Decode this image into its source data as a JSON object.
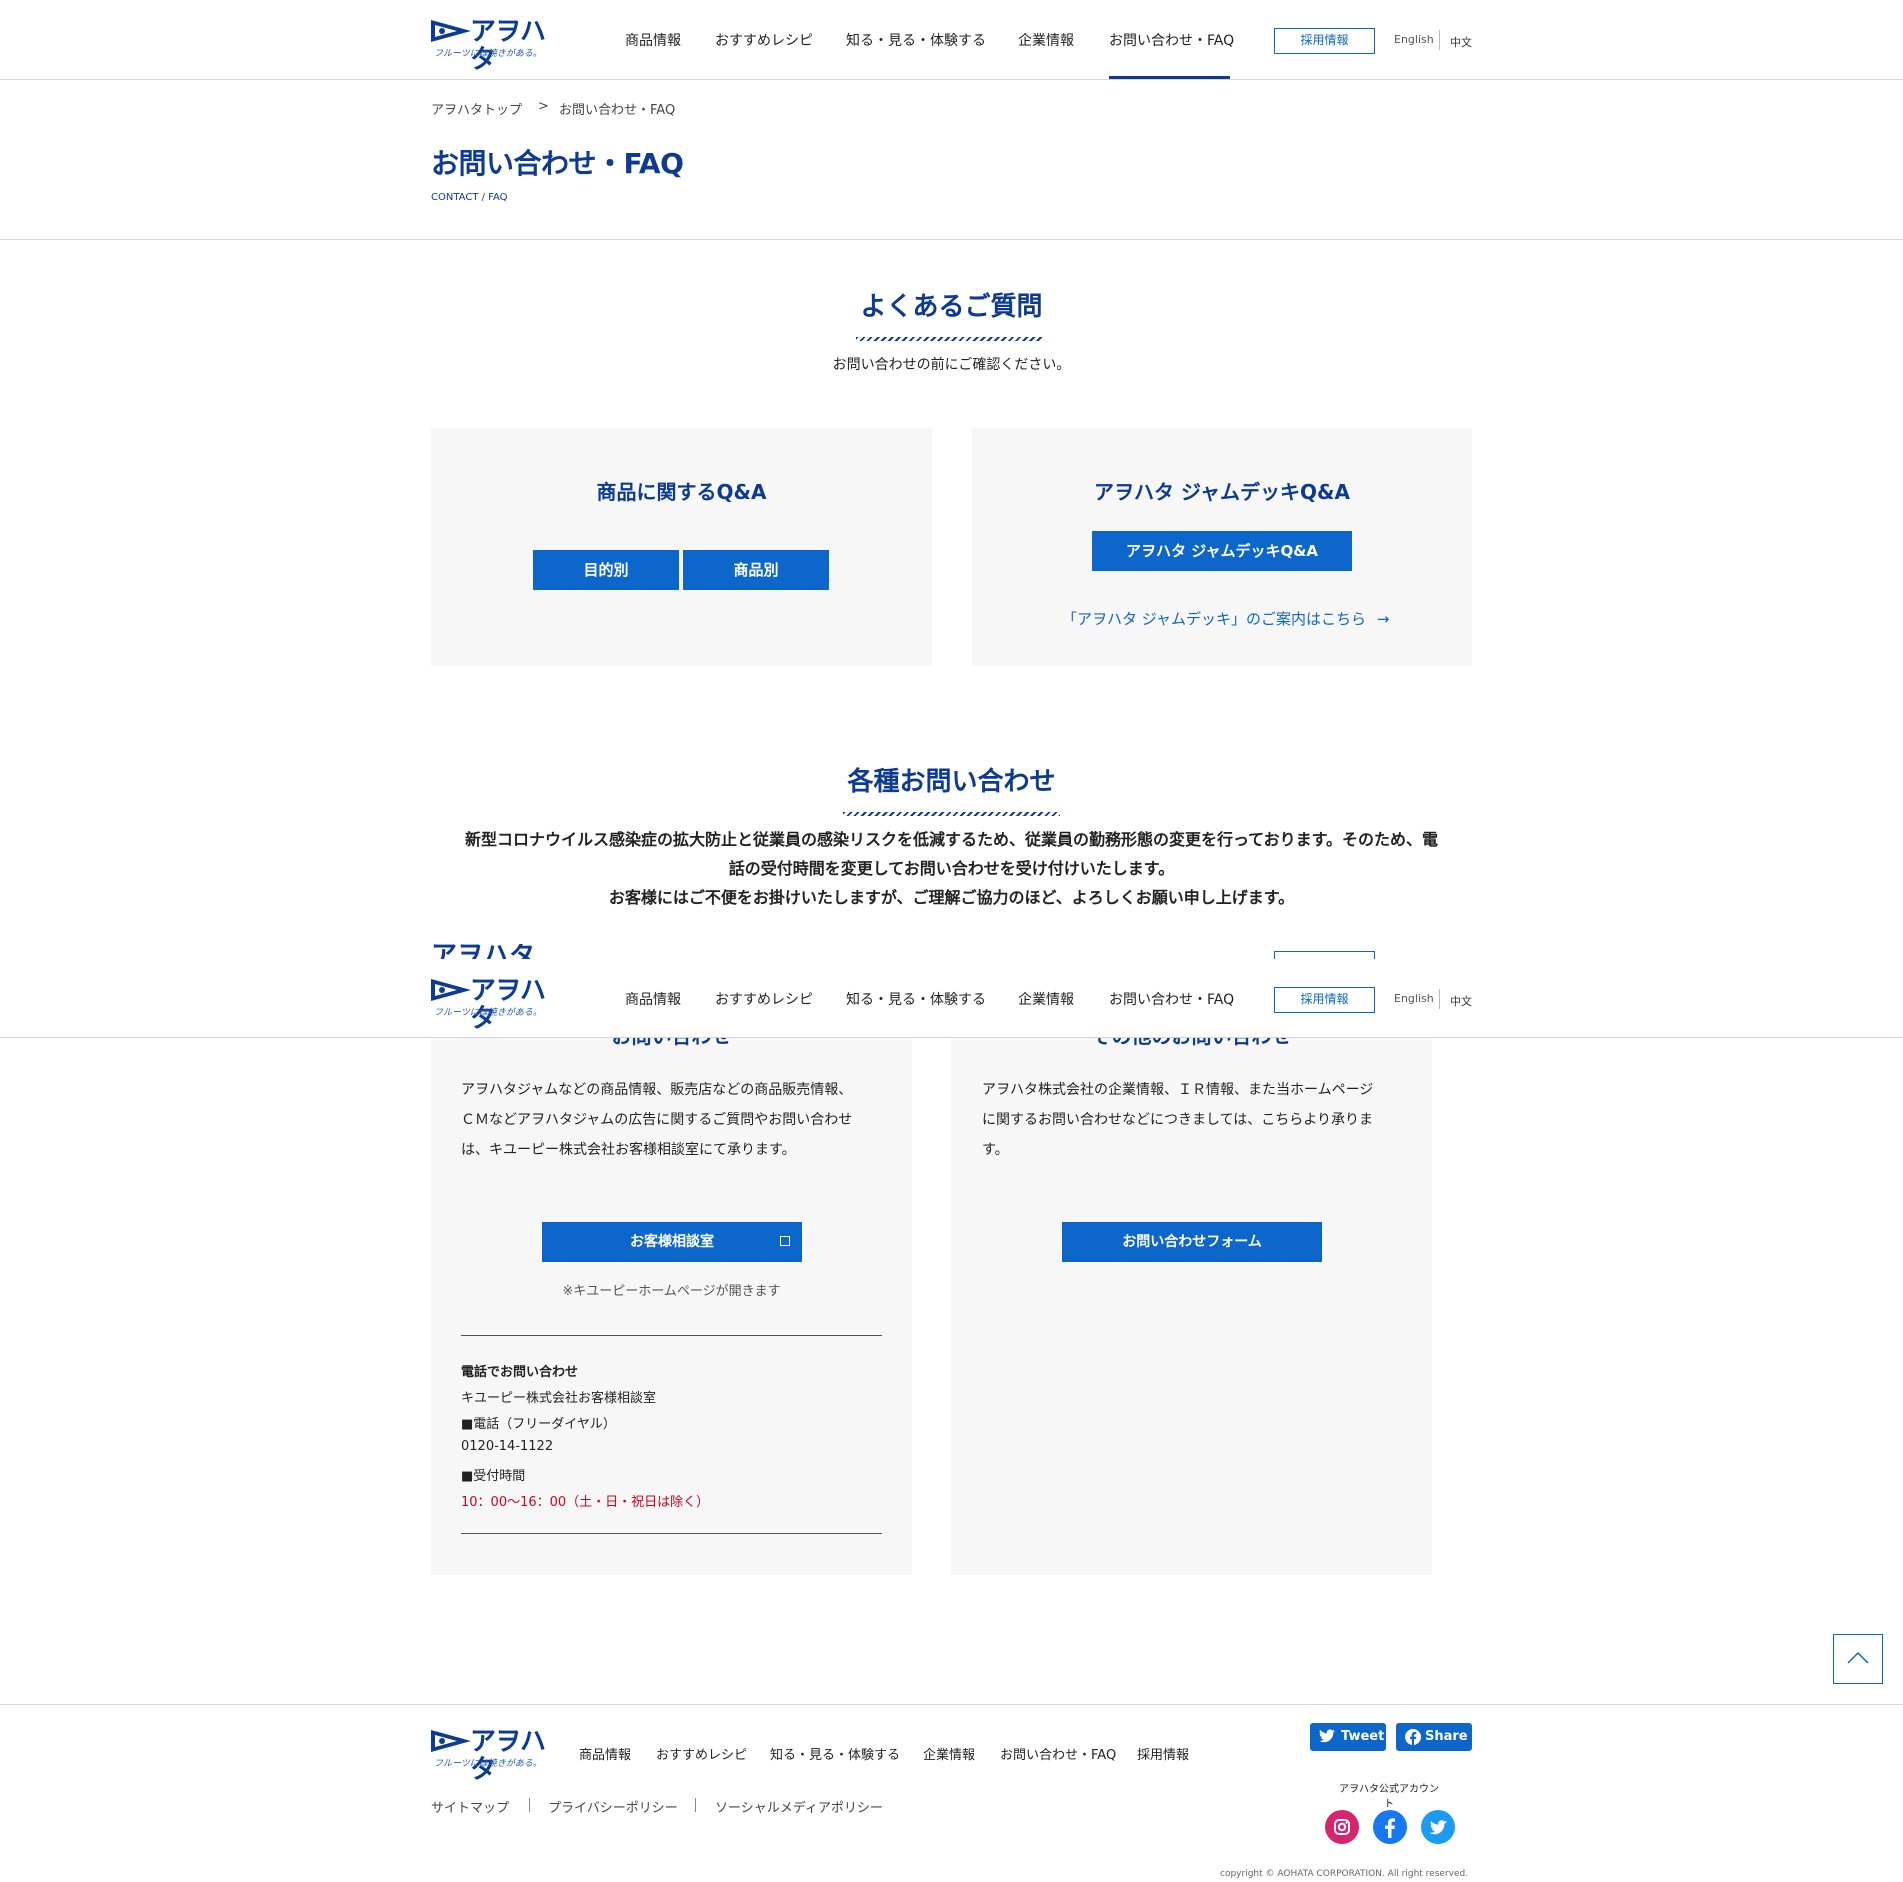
{
  "brand": {
    "logo_word": "アヲハタ",
    "logo_tagline": "フルーツには焼きがある。"
  },
  "header": {
    "nav": [
      "商品情報",
      "おすすめレシピ",
      "知る・見る・体験する",
      "企業情報",
      "お問い合わせ・FAQ"
    ],
    "recruit": "採用情報",
    "lang_en": "English",
    "lang_zh": "中文"
  },
  "breadcrumb": {
    "home": "アヲハタトップ",
    "sep": ">",
    "current": "お問い合わせ・FAQ"
  },
  "page": {
    "title": "お問い合わせ・FAQ",
    "subtitle": "CONTACT / FAQ"
  },
  "faq": {
    "title": "よくあるご質問",
    "lead": "お問い合わせの前にご確認ください。",
    "product_card": {
      "title": "商品に関するQ&A",
      "btn_purpose": "目的別",
      "btn_product": "商品別"
    },
    "jamdeck_card": {
      "title": "アヲハタ ジャムデッキQ&A",
      "btn": "アヲハタ ジャムデッキQ&A",
      "link": "「アヲハタ ジャムデッキ」のご案内はこちら"
    }
  },
  "contact": {
    "title": "各種お問い合わせ",
    "notice": [
      "新型コロナウイルス感染症の拡大防止と従業員の感染リスクを低減するため、従業員の勤務形態の変更を行っております。そのため、電",
      "話の受付時間を変更してお問い合わせを受け付けいたします。",
      "お客様にはご不便をお掛けいたしますが、ご理解ご協力のほど、よろしくお願い申し上げます。"
    ],
    "left_card": {
      "heading": "お問い合わせ",
      "body": [
        "アヲハタジャムなどの商品情報、販売店などの商品販売情報、",
        "ＣＭなどアヲハタジャムの広告に関するご質問やお問い合わせ",
        "は、キユーピー株式会社お客様相談室にて承ります。"
      ],
      "btn": "お客様相談室",
      "note": "※キユーピーホームページが開きます",
      "tel_title": "電話でお問い合わせ",
      "tel_org": "キユーピー株式会社お客様相談室",
      "tel_label": "■電話（フリーダイヤル）",
      "tel_number": "0120-14-1122",
      "hours_label": "■受付時間",
      "hours": "10：00〜16：00（土・日・祝日は除く）"
    },
    "right_card": {
      "heading": "その他のお問い合わせ",
      "body": [
        "アヲハタ株式会社の企業情報、ＩＲ情報、また当ホームページ",
        "に関するお問い合わせなどにつきましては、こちらより承りま",
        "す。"
      ],
      "btn": "お問い合わせフォーム"
    }
  },
  "footer": {
    "nav": [
      "商品情報",
      "おすすめレシピ",
      "知る・見る・体験する",
      "企業情報",
      "お問い合わせ・FAQ",
      "採用情報"
    ],
    "sub": [
      "サイトマップ",
      "プライバシーポリシー",
      "ソーシャルメディアポリシー"
    ],
    "tweet": "Tweet",
    "share": "Share",
    "official": "アヲハタ公式アカウント",
    "copyright": "copyright © AOHATA CORPORATION. All right reserved."
  },
  "colors": {
    "brand_navy": "#0d3a92",
    "button_blue": "#0d66c9",
    "card_bg": "#f7f7f7",
    "alert_red": "#d0021b"
  }
}
